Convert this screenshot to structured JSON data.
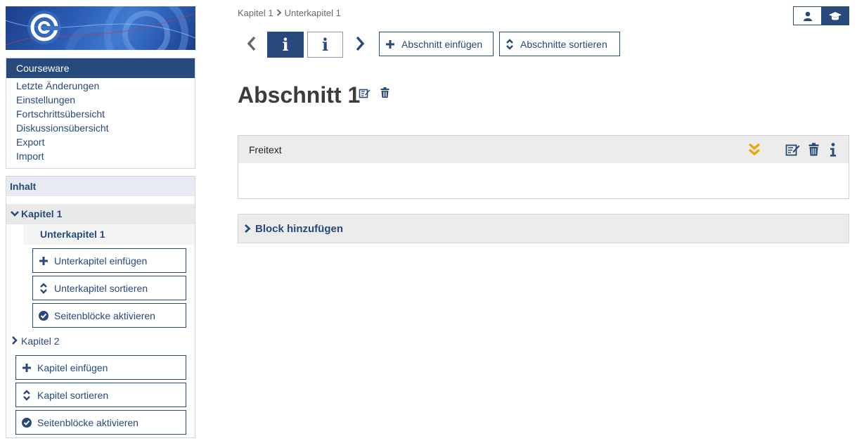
{
  "breadcrumb": [
    "Kapitel 1",
    "Unterkapitel 1"
  ],
  "nav": {
    "items": [
      "Courseware",
      "Letzte Änderungen",
      "Einstellungen",
      "Fortschrittsübersicht",
      "Diskussionsübersicht",
      "Export",
      "Import"
    ],
    "active_index": 0
  },
  "content": {
    "title": "Inhalt",
    "chapter1": "Kapitel 1",
    "subchapter1": "Unterkapitel 1",
    "sub_buttons": [
      "Unterkapitel einfügen",
      "Unterkapitel sortieren",
      "Seitenblöcke aktivieren"
    ],
    "chapter2": "Kapitel 2",
    "chap_buttons": [
      "Kapitel einfügen",
      "Kapitel sortieren",
      "Seitenblöcke aktivieren"
    ]
  },
  "toolbar": {
    "info_label": "i",
    "add_section": "Abschnitt einfügen",
    "sort_sections": "Abschnitte sortieren"
  },
  "section": {
    "title": "Abschnitt 1"
  },
  "block": {
    "title": "Freitext"
  },
  "add_block_label": "Block hinzufügen",
  "colors": {
    "primary": "#28497c",
    "accent": "#f0a400",
    "panel": "#ececec"
  },
  "icons": [
    "person-icon",
    "graduation-cap-icon",
    "chevron-left-icon",
    "chevron-right-icon",
    "plus-icon",
    "sort-icon",
    "check-circle-icon",
    "edit-icon",
    "trash-icon",
    "info-icon",
    "double-chevron-down-icon"
  ]
}
